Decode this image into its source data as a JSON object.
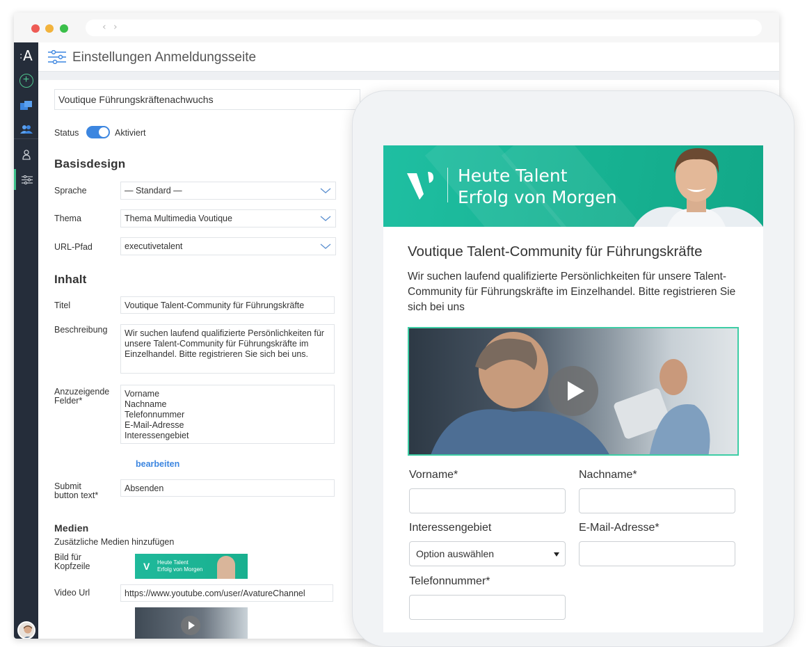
{
  "browser": {
    "nav_arrows": "‹ ›"
  },
  "sidebar": {
    "logo": "A",
    "logo_dots": ":",
    "add_symbol": "+",
    "icons": [
      "plus-circle-icon",
      "folders-icon",
      "people-icon",
      "person-icon",
      "sliders-icon"
    ]
  },
  "header": {
    "title": "Einstellungen Anmeldungsseite",
    "icon": "sliders-icon"
  },
  "form": {
    "page_name": "Voutique Führungskräftenachwuchs",
    "status_label": "Status",
    "status_value": "Aktiviert",
    "status_on": true,
    "basisdesign_heading": "Basisdesign",
    "sprache_label": "Sprache",
    "sprache_value": "— Standard —",
    "thema_label": "Thema",
    "thema_value": "Thema Multimedia Voutique",
    "url_label": "URL-Pfad",
    "url_value": "executivetalent",
    "inhalt_heading": "Inhalt",
    "titel_label": "Titel",
    "titel_value": "Voutique Talent-Community für Führungskräfte",
    "beschreibung_label": "Beschreibung",
    "beschreibung_value": "Wir suchen laufend qualifizierte Persönlichkeiten für unsere Talent-Community für Führungskräfte im Einzelhandel. Bitte registrieren Sie sich bei uns.",
    "felder_label_1": "Anzuzeigende",
    "felder_label_2": "Felder*",
    "felder": [
      "Vorname",
      "Nachname",
      "Telefonnummer",
      "E-Mail-Adresse",
      "Interessengebiet"
    ],
    "bearbeiten": "bearbeiten",
    "submit_label_1": "Submit",
    "submit_label_2": "button text*",
    "submit_value": "Absenden",
    "medien_heading": "Medien",
    "medien_sub": "Zusätzliche Medien hinzufügen",
    "bild_label_1": "Bild für",
    "bild_label_2": "Kopfzeile",
    "thumb_line1": "Heute Talent",
    "thumb_line2": "Erfolg von Morgen",
    "video_label": "Video Url",
    "video_value": "https://www.youtube.com/user/AvatureChannel"
  },
  "preview": {
    "banner_line1": "Heute Talent",
    "banner_line2": "Erfolg von Morgen",
    "title": "Voutique Talent-Community für Führungskräfte",
    "description": "Wir suchen laufend qualifizierte Persönlichkeiten für unsere Talent-Community für Führungskräfte im Einzelhandel. Bitte registrieren Sie sich bei uns",
    "vorname_label": "Vorname*",
    "nachname_label": "Nachname*",
    "interessengebiet_label": "Interessengebiet",
    "email_label": "E-Mail-Adresse*",
    "select_placeholder": "Option auswählen",
    "telefon_label": "Telefonnummer*"
  },
  "colors": {
    "accent_green": "#1fbfa2",
    "toggle_blue": "#3c86e0",
    "sidebar_bg": "#252d3a"
  }
}
